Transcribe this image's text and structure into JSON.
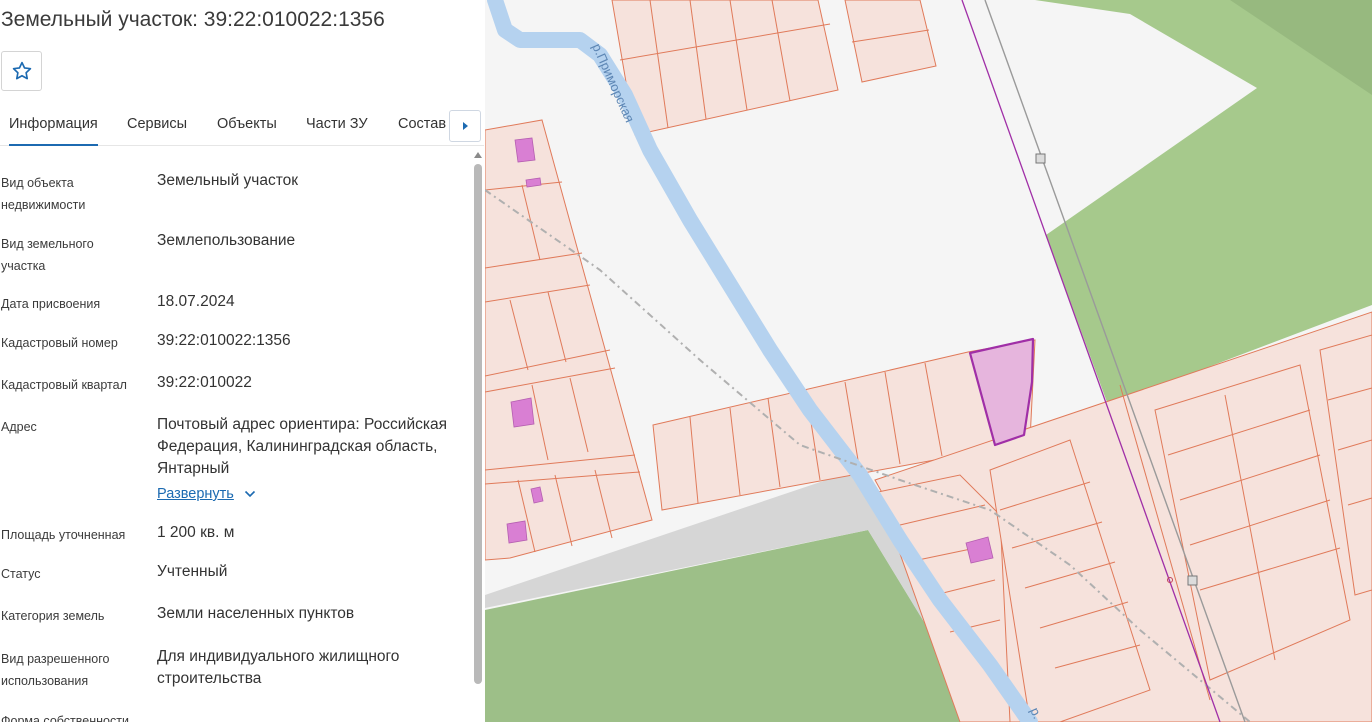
{
  "title": "Земельный участок: 39:22:010022:1356",
  "tabs": [
    {
      "label": "Информация",
      "active": true
    },
    {
      "label": "Сервисы",
      "active": false
    },
    {
      "label": "Объекты",
      "active": false
    },
    {
      "label": "Части ЗУ",
      "active": false
    },
    {
      "label": "Состав",
      "active": false
    }
  ],
  "info": [
    {
      "label": "Вид объекта недвижимости",
      "value": "Земельный участок"
    },
    {
      "label": "Вид земельного участка",
      "value": "Землепользование"
    },
    {
      "label": "Дата присвоения",
      "value": "18.07.2024"
    },
    {
      "label": "Кадастровый номер",
      "value": "39:22:010022:1356"
    },
    {
      "label": "Кадастровый квартал",
      "value": "39:22:010022"
    },
    {
      "label": "Адрес",
      "value": "Почтовый адрес ориентира: Российская Федерация, Калининградская область, Янтарный"
    },
    {
      "label": "Площадь уточненная",
      "value": "1 200 кв. м"
    },
    {
      "label": "Статус",
      "value": "Учтенный"
    },
    {
      "label": "Категория земель",
      "value": "Земли населенных пунктов"
    },
    {
      "label": "Вид разрешенного использования",
      "value": "Для индивидуального жилищного строительства"
    },
    {
      "label": "Форма собственности",
      "value": ""
    }
  ],
  "expand_label": "Развернуть",
  "map": {
    "river_label": "р.Приморская",
    "river_label_2": "р.",
    "colors": {
      "parcel_fill": "#f6e2dc",
      "parcel_stroke": "#e07a5a",
      "green": "#a6c98c",
      "forest": "#9dbf88",
      "river": "#b5d2ef",
      "road": "#d6d6d6",
      "selected_fill": "#e6b5dd",
      "selected_stroke": "#a02fa7",
      "building": "#d97fd3",
      "boundary": "#a02fa7",
      "accent": "#1c6ab1"
    }
  }
}
